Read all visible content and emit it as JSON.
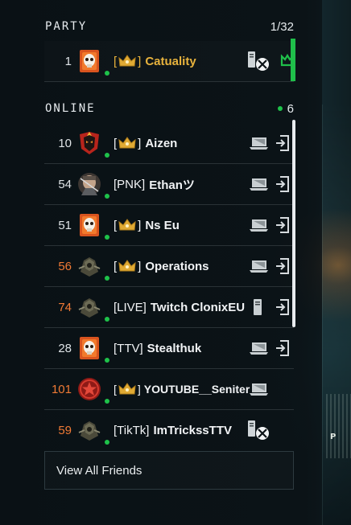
{
  "colors": {
    "online": "#1ec24a",
    "gold_name": "#e8b33d",
    "orange_rank": "#f07a35",
    "party_bar": "#1fbf4a"
  },
  "party": {
    "title": "PARTY",
    "count": "1/32",
    "members": [
      {
        "rank": "1",
        "clan_open": "[",
        "clan_close": "]",
        "clan_icon": "crown-icon",
        "name": "Catuality",
        "platform": "pc-xbox-icon",
        "emblem": "skull-emblem"
      }
    ]
  },
  "online": {
    "title": "ONLINE",
    "count": "6",
    "friends": [
      {
        "rank": "10",
        "clan_open": "[",
        "clan_close": "]",
        "clan_icon": "crown-icon",
        "name": "Aizen",
        "rank_color": "white",
        "platform": "pc-icon",
        "emblem": "fire-skull-emblem"
      },
      {
        "rank": "54",
        "clan_open": "",
        "clan_close": "",
        "clan_text": "[PNK]",
        "name": "Ethanツ",
        "rank_color": "white",
        "platform": "pc-icon",
        "emblem": "soldier-emblem"
      },
      {
        "rank": "51",
        "clan_open": "[",
        "clan_close": "]",
        "clan_icon": "crown-icon",
        "name": "Ns Eu",
        "rank_color": "white",
        "platform": "pc-icon",
        "emblem": "skull-emblem"
      },
      {
        "rank": "56",
        "clan_open": "[",
        "clan_close": "]",
        "clan_icon": "crown-icon",
        "name": "Operations",
        "rank_color": "orange",
        "platform": "pc-icon",
        "emblem": "armor-emblem"
      },
      {
        "rank": "74",
        "clan_open": "",
        "clan_close": "",
        "clan_text": "[LIVE]",
        "name": "Twitch ClonixEU",
        "rank_color": "orange",
        "platform": "tower-icon",
        "emblem": "armor-emblem"
      },
      {
        "rank": "28",
        "clan_open": "",
        "clan_close": "",
        "clan_text": "[TTV]",
        "name": "Stealthuk",
        "rank_color": "white",
        "platform": "pc-icon",
        "emblem": "skull-emblem"
      },
      {
        "rank": "101",
        "clan_open": "[",
        "clan_close": "]",
        "clan_icon": "crown-icon",
        "name": "YOUTUBE__Seniter",
        "rank_color": "orange",
        "platform": "pc-icon",
        "emblem": "red-seal-emblem"
      },
      {
        "rank": "59",
        "clan_open": "",
        "clan_close": "",
        "clan_text": "[TikTk]",
        "name": "ImTrickssTTV",
        "rank_color": "orange",
        "platform": "pc-xbox-icon",
        "emblem": "armor-emblem"
      }
    ]
  },
  "footer": {
    "view_all_label": "View All Friends"
  }
}
